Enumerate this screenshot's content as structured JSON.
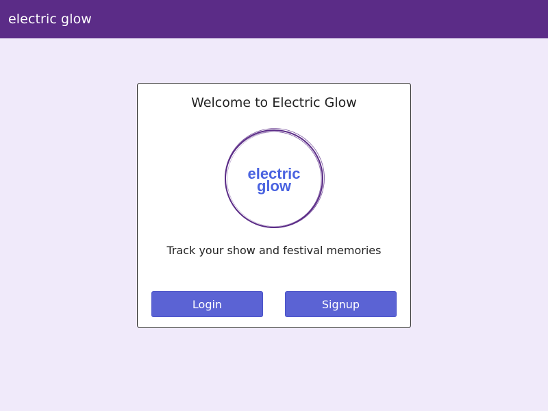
{
  "header": {
    "app_title": "electric glow"
  },
  "card": {
    "title": "Welcome to Electric Glow",
    "logo": {
      "line1": "electric",
      "line2": "glow",
      "ring_color": "#5b2c87",
      "text_color": "#4a63e0"
    },
    "tagline": "Track your show and festival memories",
    "login_label": "Login",
    "signup_label": "Signup"
  },
  "colors": {
    "header_bg": "#5b2c87",
    "page_bg": "#f0eafa",
    "button_bg": "#5b63d4"
  }
}
